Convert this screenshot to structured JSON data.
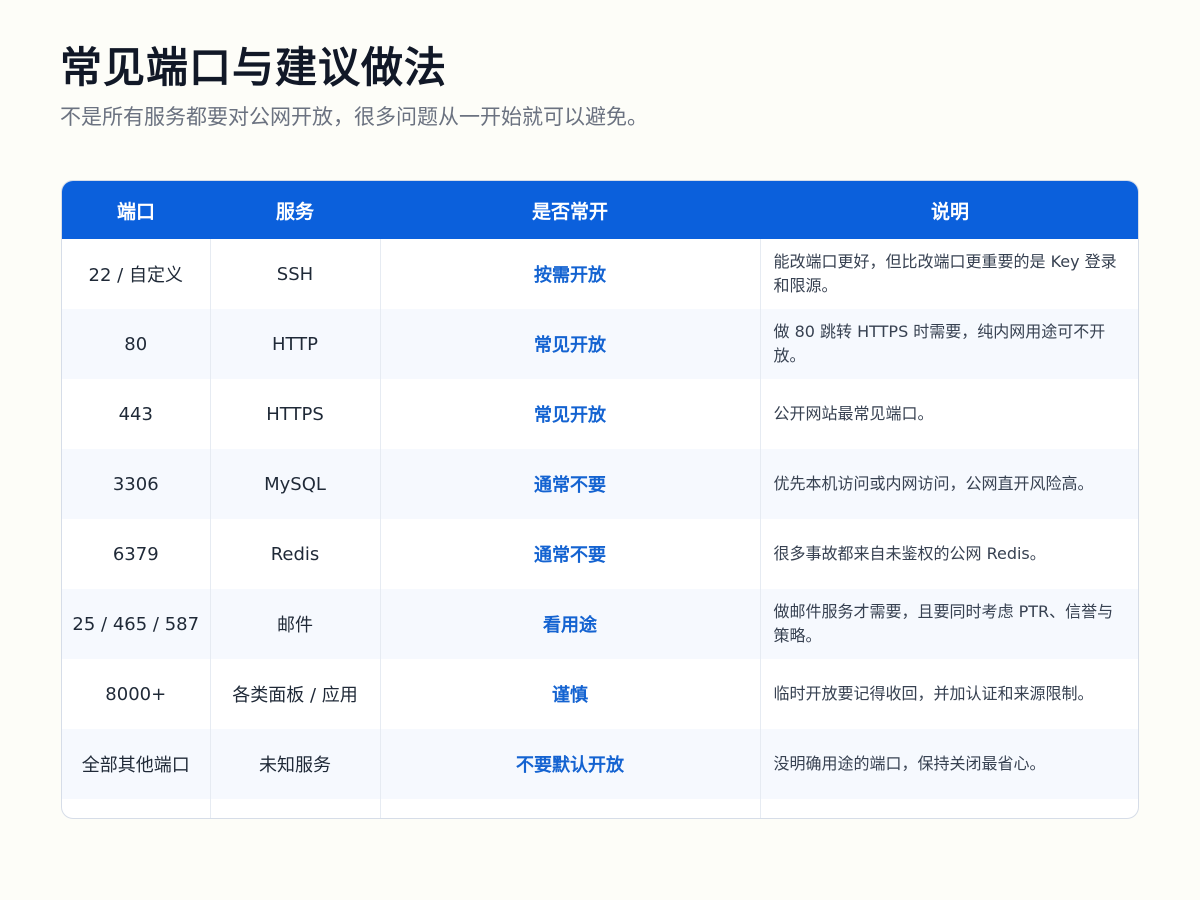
{
  "page": {
    "title": "常见端口与建议做法",
    "subtitle": "不是所有服务都要对公网开放，很多问题从一开始就可以避免。"
  },
  "table": {
    "headers": {
      "port": "端口",
      "service": "服务",
      "open": "是否常开",
      "note": "说明"
    },
    "rows": [
      {
        "port": "22 / 自定义",
        "service": "SSH",
        "open": "按需开放",
        "note": "能改端口更好，但比改端口更重要的是 Key 登录和限源。"
      },
      {
        "port": "80",
        "service": "HTTP",
        "open": "常见开放",
        "note": "做 80 跳转 HTTPS 时需要，纯内网用途可不开放。"
      },
      {
        "port": "443",
        "service": "HTTPS",
        "open": "常见开放",
        "note": "公开网站最常见端口。"
      },
      {
        "port": "3306",
        "service": "MySQL",
        "open": "通常不要",
        "note": "优先本机访问或内网访问，公网直开风险高。"
      },
      {
        "port": "6379",
        "service": "Redis",
        "open": "通常不要",
        "note": "很多事故都来自未鉴权的公网 Redis。"
      },
      {
        "port": "25 / 465 / 587",
        "service": "邮件",
        "open": "看用途",
        "note": "做邮件服务才需要，且要同时考虑 PTR、信誉与策略。"
      },
      {
        "port": "8000+",
        "service": "各类面板 / 应用",
        "open": "谨慎",
        "note": "临时开放要记得收回，并加认证和来源限制。"
      },
      {
        "port": "全部其他端口",
        "service": "未知服务",
        "open": "不要默认开放",
        "note": "没明确用途的端口，保持关闭最省心。"
      }
    ]
  },
  "colors": {
    "header_bg": "#0b60dc",
    "accent_text": "#1463d1",
    "page_bg": "#fdfdf8"
  }
}
